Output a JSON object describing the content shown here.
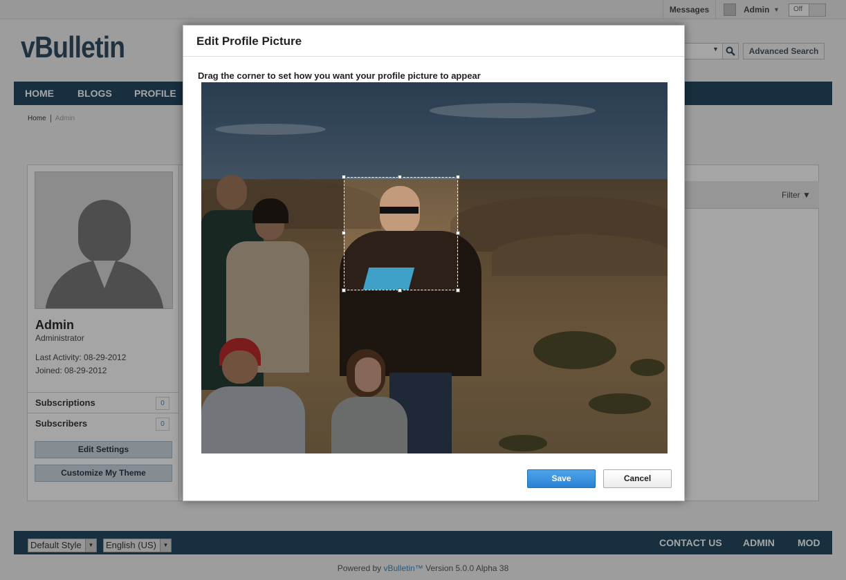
{
  "topbar": {
    "messages": "Messages",
    "user": "Admin",
    "toggle": "Off"
  },
  "header": {
    "logo": "vBulletin",
    "advanced_search": "Advanced Search"
  },
  "nav": {
    "items": [
      "HOME",
      "BLOGS",
      "PROFILE"
    ]
  },
  "breadcrumb": {
    "home": "Home",
    "current": "Admin"
  },
  "profile": {
    "name": "Admin",
    "role": "Administrator",
    "last_activity": "Last Activity: 08-29-2012",
    "joined": "Joined: 08-29-2012",
    "subscriptions_label": "Subscriptions",
    "subscriptions_count": "0",
    "subscribers_label": "Subscribers",
    "subscribers_count": "0",
    "edit_settings": "Edit Settings",
    "customize_theme": "Customize My Theme"
  },
  "activity": {
    "filter": "Filter"
  },
  "modal": {
    "title": "Edit Profile Picture",
    "instruction": "Drag the corner to set how you want your profile picture to appear",
    "save": "Save",
    "cancel": "Cancel"
  },
  "footer": {
    "style_select": "Default Style",
    "language_select": "English (US)",
    "links": [
      "CONTACT US",
      "ADMIN",
      "MOD"
    ],
    "powered_prefix": "Powered by ",
    "powered_link": "vBulletin™",
    "powered_suffix": " Version 5.0.0 Alpha 38"
  },
  "colors": {
    "nav_bg": "#0b3450",
    "save_button": "#2a82d3"
  }
}
